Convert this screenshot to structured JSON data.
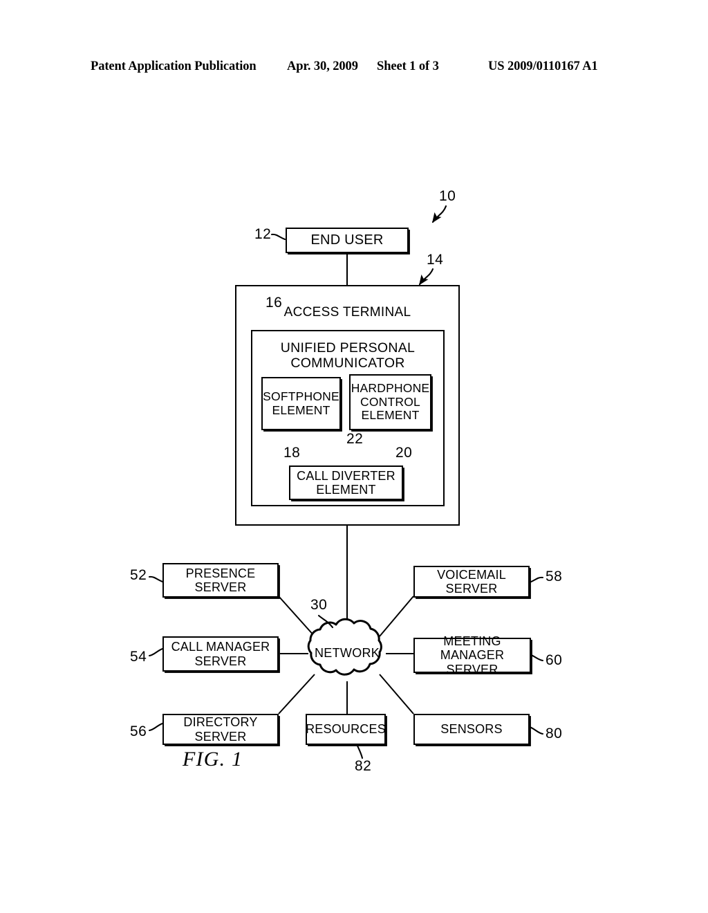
{
  "header": {
    "publication": "Patent Application Publication",
    "date": "Apr. 30, 2009",
    "sheet": "Sheet 1 of 3",
    "patent_number": "US 2009/0110167 A1"
  },
  "figure": {
    "caption": "FIG. 1",
    "nodes": {
      "end_user": "END USER",
      "access_terminal": "ACCESS TERMINAL",
      "unified_personal_communicator": "UNIFIED PERSONAL\nCOMMUNICATOR",
      "unified_personal_communicator_line1": "UNIFIED PERSONAL",
      "unified_personal_communicator_line2": "COMMUNICATOR",
      "softphone_element_line1": "SOFTPHONE",
      "softphone_element_line2": "ELEMENT",
      "hardphone_control_element_line1": "HARDPHONE",
      "hardphone_control_element_line2": "CONTROL",
      "hardphone_control_element_line3": "ELEMENT",
      "call_diverter_element_line1": "CALL DIVERTER",
      "call_diverter_element_line2": "ELEMENT",
      "network": "NETWORK",
      "presence_server_line1": "PRESENCE",
      "presence_server_line2": "SERVER",
      "call_manager_server_line1": "CALL MANAGER",
      "call_manager_server_line2": "SERVER",
      "directory_server": "DIRECTORY SERVER",
      "resources": "RESOURCES",
      "voicemail_server": "VOICEMAIL SERVER",
      "meeting_manager_server_line1": "MEETING MANAGER",
      "meeting_manager_server_line2": "SERVER",
      "sensors": "SENSORS"
    },
    "reference_numerals": {
      "system": "10",
      "end_user": "12",
      "access_terminal": "14",
      "unified_personal_communicator": "16",
      "softphone_element": "18",
      "hardphone_control_element": "20",
      "call_diverter_element": "22",
      "network": "30",
      "presence_server": "52",
      "call_manager_server": "54",
      "directory_server": "56",
      "voicemail_server": "58",
      "meeting_manager_server": "60",
      "sensors": "80",
      "resources": "82"
    }
  }
}
